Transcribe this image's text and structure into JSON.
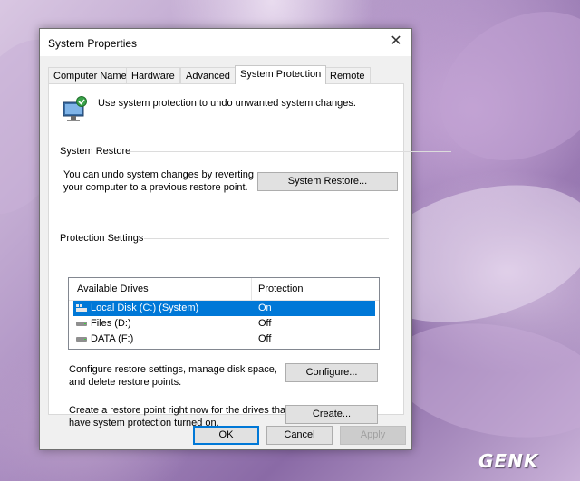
{
  "window": {
    "title": "System Properties"
  },
  "tabs": [
    {
      "label": "Computer Name",
      "active": false
    },
    {
      "label": "Hardware",
      "active": false
    },
    {
      "label": "Advanced",
      "active": false
    },
    {
      "label": "System Protection",
      "active": true
    },
    {
      "label": "Remote",
      "active": false
    }
  ],
  "intro": "Use system protection to undo unwanted system changes.",
  "system_restore": {
    "title": "System Restore",
    "description_line1": "You can undo system changes by reverting",
    "description_line2": "your computer to a previous restore point.",
    "button": "System Restore..."
  },
  "protection": {
    "title": "Protection Settings",
    "columns": [
      "Available Drives",
      "Protection"
    ],
    "drives": [
      {
        "name": "Local Disk (C:) (System)",
        "protection": "On",
        "selected": true,
        "icon": "system-drive-icon"
      },
      {
        "name": "Files (D:)",
        "protection": "Off",
        "selected": false,
        "icon": "drive-icon"
      },
      {
        "name": "DATA (F:)",
        "protection": "Off",
        "selected": false,
        "icon": "drive-icon"
      }
    ],
    "configure_text_line1": "Configure restore settings, manage disk space,",
    "configure_text_line2": "and delete restore points.",
    "configure_button": "Configure...",
    "create_text_line1": "Create a restore point right now for the drives that",
    "create_text_line2": "have system protection turned on.",
    "create_button": "Create..."
  },
  "footer": {
    "ok": "OK",
    "cancel": "Cancel",
    "apply": "Apply"
  },
  "watermark": "GENK",
  "colors": {
    "accent": "#0078d7",
    "window_bg": "#f0f0f0",
    "panel_bg": "#ffffff"
  }
}
